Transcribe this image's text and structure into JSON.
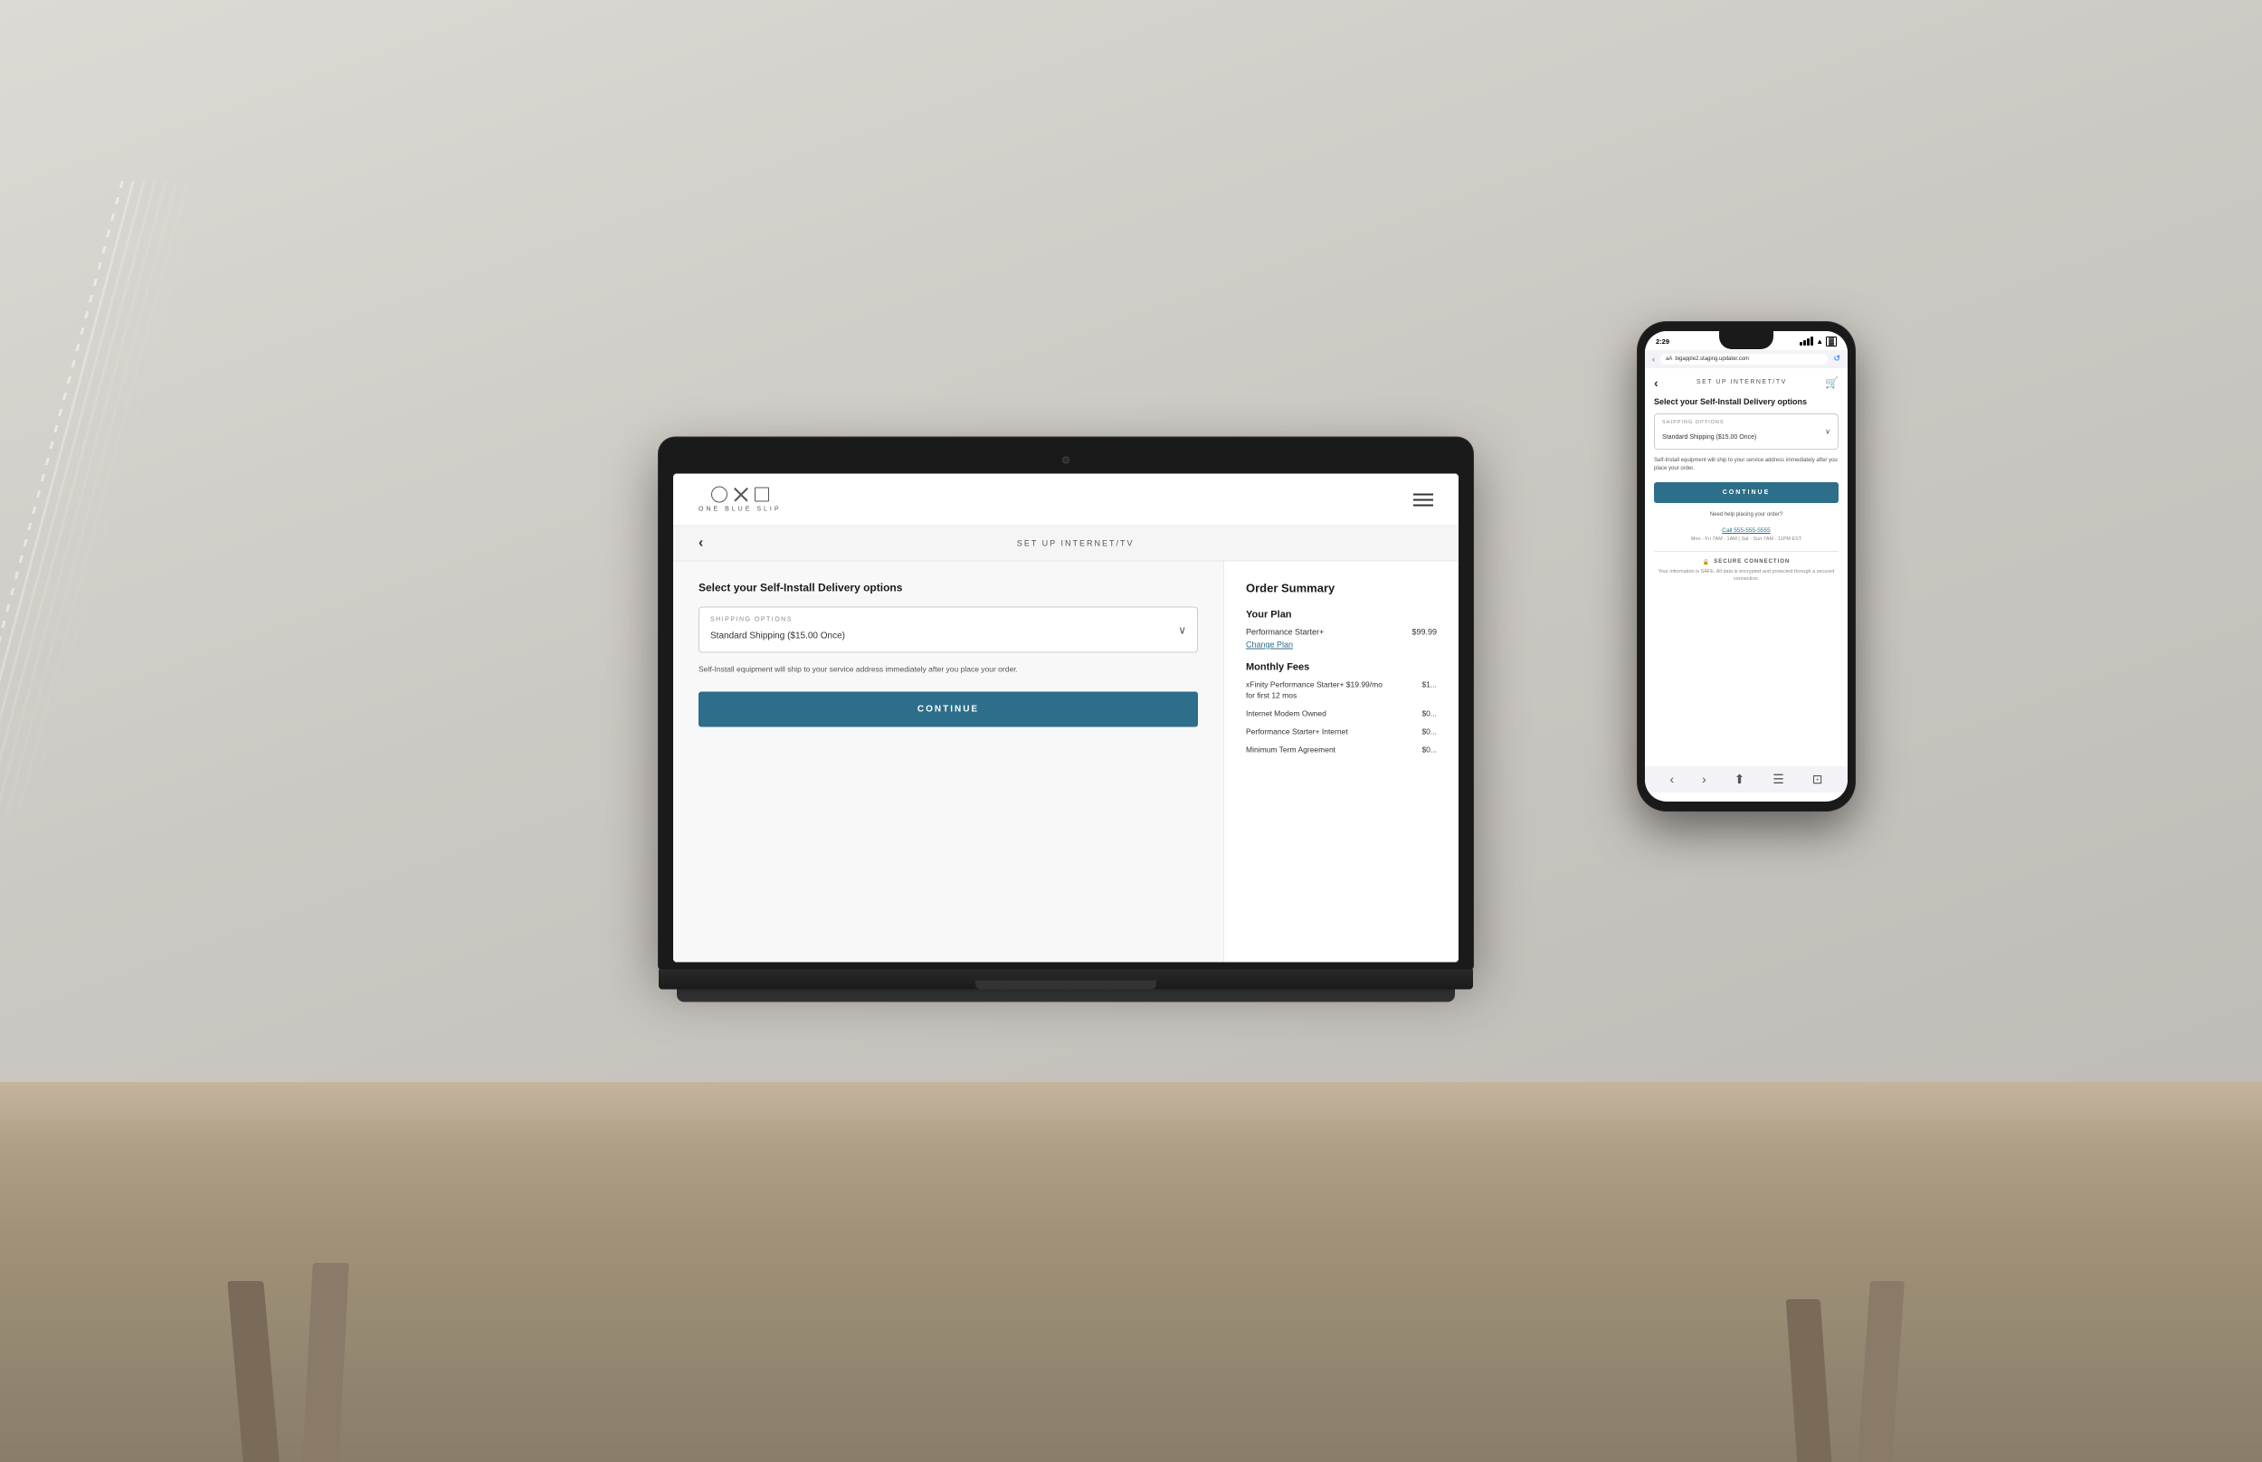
{
  "background": {
    "color": "#e0dbd5"
  },
  "laptop": {
    "header": {
      "logo_text": "ONE BLUE SLIP",
      "menu_label": "menu"
    },
    "nav": {
      "back_label": "‹",
      "page_title": "SET UP INTERNET/TV"
    },
    "main": {
      "section_title": "Select your Self-Install Delivery options",
      "shipping_options_label": "SHIPPING OPTIONS",
      "shipping_options_value": "Standard Shipping ($15.00 Once)",
      "shipping_note": "Self-Install equipment will ship to your service address immediately after you place your order.",
      "continue_button": "CONTINUE"
    },
    "sidebar": {
      "order_summary_title": "Order Summary",
      "your_plan_title": "Your Plan",
      "plan_name": "Performance Starter+",
      "plan_price": "$99.99",
      "change_plan_link": "Change Plan",
      "monthly_fees_title": "Monthly Fees",
      "fees": [
        {
          "name": "xFinity Performance Starter+ $19.99/mo for first 12 mos",
          "amount": "$1..."
        },
        {
          "name": "Internet Modem Owned",
          "amount": "$0..."
        },
        {
          "name": "Performance Starter+ Internet",
          "amount": "$0..."
        },
        {
          "name": "Minimum Term Agreement",
          "amount": "$0..."
        }
      ]
    }
  },
  "phone": {
    "status_bar": {
      "time": "2:29",
      "signal": "●●●●",
      "wifi": "wifi",
      "battery": "battery"
    },
    "browser": {
      "url": "bigapple2.staging.updater.com",
      "back_label": "‹",
      "reload_label": "↺",
      "aA_label": "aA"
    },
    "nav": {
      "back_label": "‹",
      "page_title": "SET UP INTERNET/TV",
      "cart_icon": "🛒"
    },
    "main": {
      "section_title": "Select your Self-Install Delivery options",
      "shipping_options_label": "SHIPPING OPTIONS",
      "shipping_options_value": "Standard Shipping ($15.00 Once)",
      "shipping_note": "Self-Install equipment will ship to your service address immediately after you place your order.",
      "continue_button": "CONTINUE"
    },
    "help": {
      "text": "Need help placing your order?",
      "phone": "Call 555-555-5555",
      "hours": "Mon - Fri 7AM - 1AM | Sat - Sun 7AM - 11PM EST"
    },
    "secure": {
      "title": "SECURE CONNECTION",
      "text": "Your information is SAFE. All data is encrypted and protected through a secured connection."
    }
  }
}
